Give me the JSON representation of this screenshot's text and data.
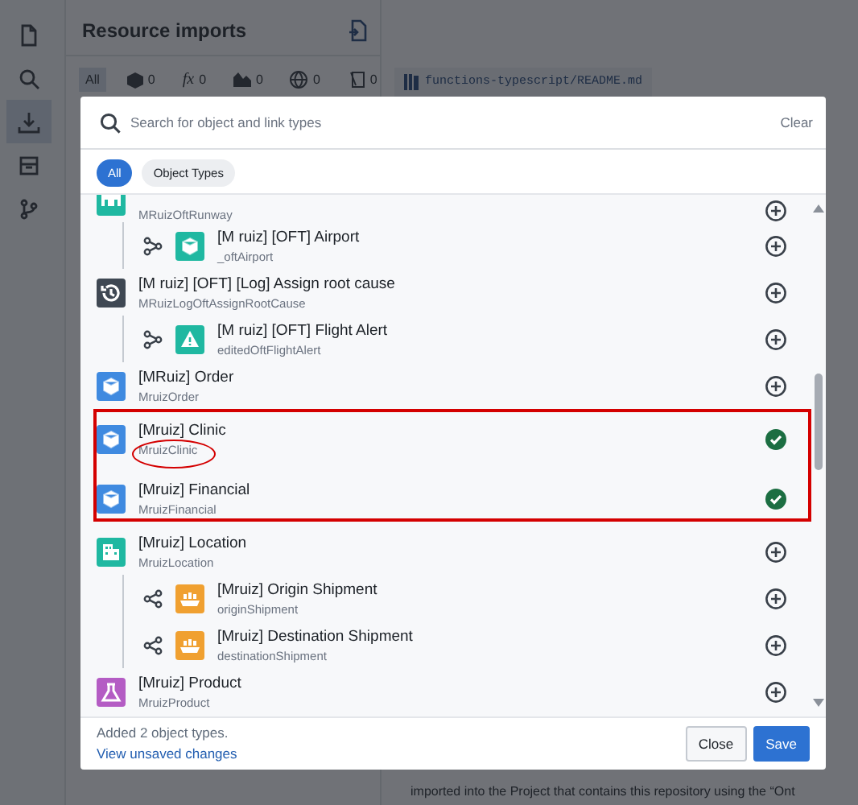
{
  "background": {
    "panel_title": "Resource imports",
    "filters": [
      {
        "kind": "all",
        "label": "All",
        "selected": true
      },
      {
        "kind": "object",
        "count": "0",
        "selected": false
      },
      {
        "kind": "function",
        "symbol": "fx",
        "count": "0",
        "selected": false
      },
      {
        "kind": "chart",
        "count": "0",
        "selected": false
      },
      {
        "kind": "globe",
        "count": "0",
        "selected": false
      },
      {
        "kind": "code",
        "count": "0",
        "selected": false
      }
    ],
    "rail": [
      {
        "kind": "file",
        "selected": false
      },
      {
        "kind": "search",
        "selected": false
      },
      {
        "kind": "download",
        "selected": true
      },
      {
        "kind": "box",
        "selected": false
      },
      {
        "kind": "branch",
        "selected": false
      }
    ],
    "file_tab": "functions-typescript/README.md",
    "bottom_text": "imported into the Project that contains this repository using the “Ont"
  },
  "dialog": {
    "search": {
      "placeholder": "Search for object and link types"
    },
    "clear": "Clear",
    "chips": [
      {
        "label": "All",
        "selected": true
      },
      {
        "label": "Object Types",
        "selected": false
      }
    ],
    "items": [
      {
        "kind": "runway",
        "subtitle": "MRuizOftRunway",
        "color": "#1fb8a1",
        "added": false,
        "children": [
          {
            "kind": "cube",
            "connector": {
              "kind": "branch"
            },
            "title": "[M ruiz] [OFT] Airport",
            "subtitle": "_oftAirport",
            "color": "#1fb8a1",
            "added": false
          }
        ]
      },
      {
        "kind": "history",
        "title": "[M ruiz] [OFT] [Log] Assign root cause",
        "subtitle": "MRuizLogOftAssignRootCause",
        "color": "#3f4853",
        "added": false,
        "children": [
          {
            "kind": "alert",
            "connector": {
              "kind": "branch"
            },
            "title": "[M ruiz] [OFT] Flight Alert",
            "subtitle": "editedOftFlightAlert",
            "color": "#1fb8a1",
            "added": false
          }
        ]
      },
      {
        "kind": "cube",
        "title": "[MRuiz] Order",
        "subtitle": "MruizOrder",
        "color": "#3f8ae0",
        "added": false
      },
      {
        "kind": "cube",
        "title": "[Mruiz] Clinic",
        "subtitle": "MruizClinic",
        "color": "#3f8ae0",
        "added": true
      },
      {
        "kind": "cube",
        "title": "[Mruiz] Financial",
        "subtitle": "MruizFinancial",
        "color": "#3f8ae0",
        "added": true
      },
      {
        "kind": "building",
        "title": "[Mruiz] Location",
        "subtitle": "MruizLocation",
        "color": "#1fb8a1",
        "added": false,
        "children": [
          {
            "kind": "ship",
            "connector": {
              "kind": "share"
            },
            "title": "[Mruiz] Origin Shipment",
            "subtitle": "originShipment",
            "color": "#f0a030",
            "added": false
          },
          {
            "kind": "ship",
            "connector": {
              "kind": "share"
            },
            "title": "[Mruiz] Destination Shipment",
            "subtitle": "destinationShipment",
            "color": "#f0a030",
            "added": false
          }
        ]
      },
      {
        "kind": "flask",
        "title": "[Mruiz] Product",
        "subtitle": "MruizProduct",
        "color": "#b45cc4",
        "added": false
      }
    ],
    "footer": {
      "message": "Added 2 object types.",
      "link": "View unsaved changes",
      "buttons": [
        {
          "label": "Close",
          "kind": "secondary"
        },
        {
          "label": "Save",
          "kind": "primary"
        }
      ]
    }
  }
}
